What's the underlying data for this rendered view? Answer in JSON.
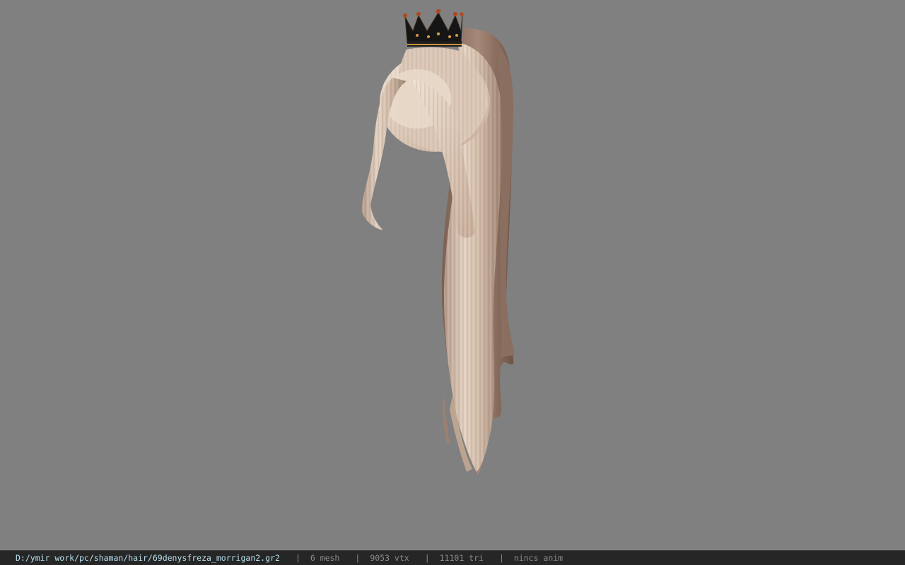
{
  "viewport": {
    "background": "#808080",
    "model_icon": "hair-ponytail-with-crown"
  },
  "status": {
    "path": "D:/ymir work/pc/shaman/hair/69denysfreza_morrigan2.gr2",
    "separator": "|",
    "mesh": "6 mesh",
    "vtx": "9053 vtx",
    "tri": "11101 tri",
    "anim": "nincs anim"
  },
  "colors": {
    "statusbar_bg": "#262626",
    "path_text": "#b8e2f0",
    "info_text": "#8c8c8c",
    "hair_light": "#e6d5c6",
    "hair_dark": "#8a6e5e",
    "crown": "#151515",
    "crown_gold": "#c8913a"
  }
}
